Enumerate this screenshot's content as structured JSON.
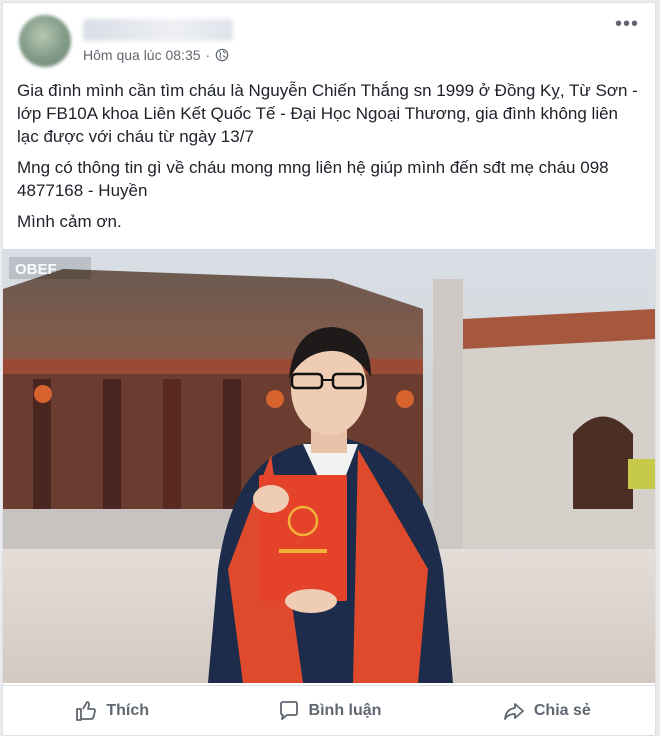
{
  "post": {
    "timestamp": "Hôm qua lúc 08:35",
    "separator": "·",
    "paragraphs": [
      "Gia đình mình cần tìm cháu là Nguyễn Chiến Thắng sn 1999 ở Đồng Kỵ, Từ Sơn - lớp FB10A khoa Liên Kết Quốc Tế - Đại Học Ngoại Thương, gia đình không liên lạc được với cháu từ ngày 13/7",
      "Mng có thông tin gì về cháu mong mng liên hệ giúp mình đến sđt mẹ cháu 098 4877168 - Huyền",
      "Mình cảm ơn."
    ],
    "more_label": "•••",
    "watermark": "OBEF"
  },
  "actions": {
    "like": "Thích",
    "comment": "Bình luận",
    "share": "Chia sẻ"
  },
  "colors": {
    "background": "#e9ebee",
    "text": "#1d2129",
    "meta": "#606770"
  }
}
